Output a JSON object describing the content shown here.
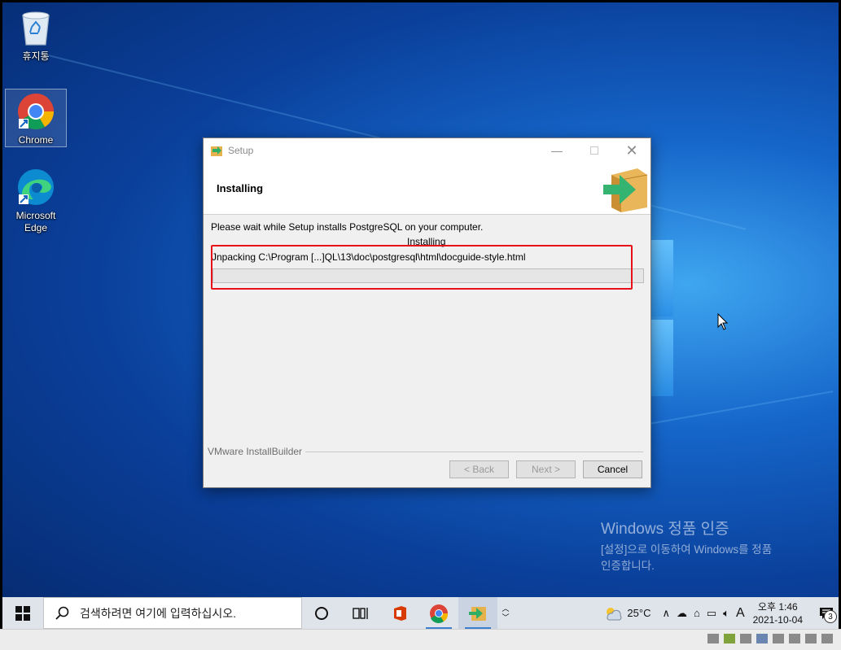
{
  "desktop": {
    "icons": [
      {
        "label": "휴지통"
      },
      {
        "label": "Chrome"
      },
      {
        "label": "Microsoft\nEdge"
      }
    ]
  },
  "setup": {
    "title": "Setup",
    "header_title": "Installing",
    "wait_message": "Please wait while Setup installs PostgreSQL on your computer.",
    "status_label": "Installing",
    "unpack_message": "Jnpacking C:\\Program [...]QL\\13\\doc\\postgresql\\html\\docguide-style.html",
    "progress_value": 0,
    "brand": "VMware InstallBuilder",
    "back_label": "< Back",
    "next_label": "Next >",
    "cancel_label": "Cancel",
    "highlight_color": "#e8111a"
  },
  "activation": {
    "title": "Windows 정품 인증",
    "line1": "[설정]으로 이동하여 Windows를 정품",
    "line2": "인증합니다."
  },
  "taskbar": {
    "search_placeholder": "검색하려면 여기에 입력하십시오.",
    "weather": "25°C",
    "ime": "A",
    "time": "오후 1:46",
    "date": "2021-10-04",
    "notifications": "3"
  }
}
